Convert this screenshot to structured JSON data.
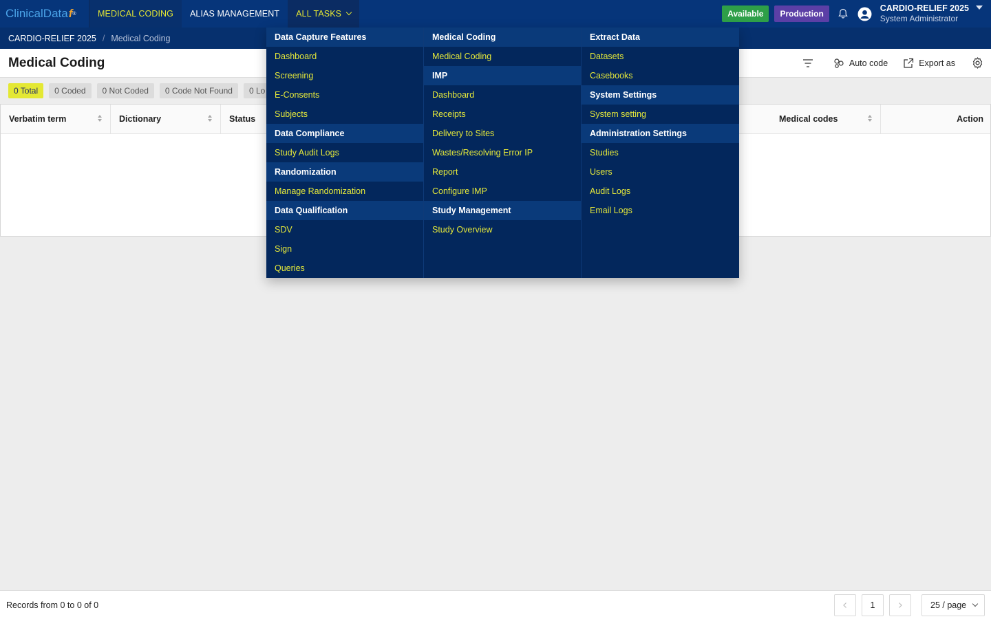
{
  "brand": {
    "name": "ClinicalData",
    "swash": "f",
    "mark": "®"
  },
  "nav": {
    "items": [
      {
        "label": "MEDICAL CODING"
      },
      {
        "label": "ALIAS MANAGEMENT"
      },
      {
        "label": "ALL TASKS"
      }
    ]
  },
  "header": {
    "available": "Available",
    "environment": "Production",
    "study": "CARDIO-RELIEF 2025",
    "role": "System Administrator"
  },
  "breadcrumb": {
    "study": "CARDIO-RELIEF 2025",
    "separator": "/",
    "page": "Medical Coding"
  },
  "page": {
    "title": "Medical Coding"
  },
  "toolbar": {
    "auto_code": "Auto code",
    "export": "Export as"
  },
  "status_filters": [
    {
      "label": "0 Total"
    },
    {
      "label": "0 Coded"
    },
    {
      "label": "0 Not Coded"
    },
    {
      "label": "0 Code Not Found"
    },
    {
      "label": "0 Lo"
    }
  ],
  "table": {
    "columns": [
      "Verbatim term",
      "Dictionary",
      "Status",
      "Medical codes",
      "Action"
    ]
  },
  "footer": {
    "records": "Records from 0 to 0 of 0",
    "current_page": "1",
    "page_size": "25 / page"
  },
  "menu": {
    "columns": [
      [
        {
          "label": "Data Capture Features",
          "header": true
        },
        {
          "label": "Dashboard"
        },
        {
          "label": "Screening"
        },
        {
          "label": "E-Consents"
        },
        {
          "label": "Subjects"
        },
        {
          "label": "Data Compliance",
          "header": true
        },
        {
          "label": "Study Audit Logs"
        },
        {
          "label": "Randomization",
          "header": true
        },
        {
          "label": "Manage Randomization"
        },
        {
          "label": "Data Qualification",
          "header": true
        },
        {
          "label": "SDV"
        },
        {
          "label": "Sign"
        },
        {
          "label": "Queries"
        }
      ],
      [
        {
          "label": "Medical Coding",
          "header": true
        },
        {
          "label": "Medical Coding"
        },
        {
          "label": "IMP",
          "header": true
        },
        {
          "label": "Dashboard"
        },
        {
          "label": "Receipts"
        },
        {
          "label": "Delivery to Sites"
        },
        {
          "label": "Wastes/Resolving Error IP"
        },
        {
          "label": "Report"
        },
        {
          "label": "Configure IMP"
        },
        {
          "label": "Study Management",
          "header": true
        },
        {
          "label": "Study Overview"
        }
      ],
      [
        {
          "label": "Extract Data",
          "header": true
        },
        {
          "label": "Datasets"
        },
        {
          "label": "Casebooks"
        },
        {
          "label": "System Settings",
          "header": true
        },
        {
          "label": "System setting"
        },
        {
          "label": "Administration Settings",
          "header": true
        },
        {
          "label": "Studies"
        },
        {
          "label": "Users"
        },
        {
          "label": "Audit Logs"
        },
        {
          "label": "Email Logs"
        }
      ]
    ]
  },
  "colors": {
    "navy": "#06357a",
    "menu_bg": "#03275c",
    "menu_header": "#0a3a7a",
    "accent_yellow": "#e2e534",
    "available_green": "#2e9f48",
    "production_purple": "#5b3fa6"
  }
}
